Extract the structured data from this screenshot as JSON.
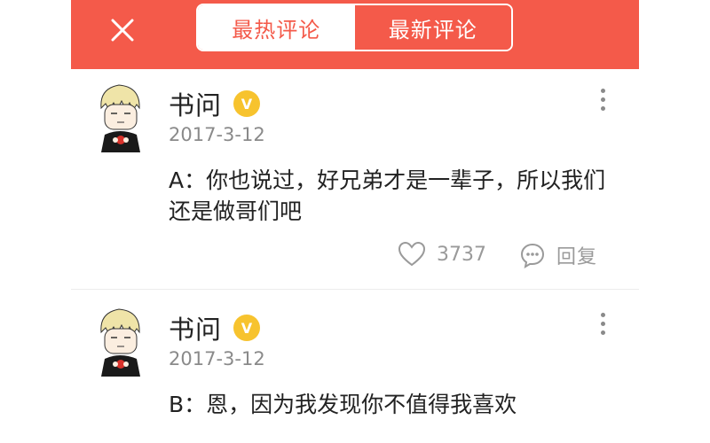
{
  "header": {
    "close_icon": "close-icon",
    "tabs": [
      {
        "label": "最热评论",
        "active": true
      },
      {
        "label": "最新评论",
        "active": false
      }
    ],
    "accent_color": "#f45a4a"
  },
  "comments": [
    {
      "author": "书问",
      "verified_badge": "V",
      "date": "2017-3-12",
      "text": "A：你也说过，好兄弟才是一辈子，所以我们还是做哥们吧",
      "likes": "3737",
      "reply_label": "回复"
    },
    {
      "author": "书问",
      "verified_badge": "V",
      "date": "2017-3-12",
      "text": "B：恩，因为我发现你不值得我喜欢"
    }
  ]
}
